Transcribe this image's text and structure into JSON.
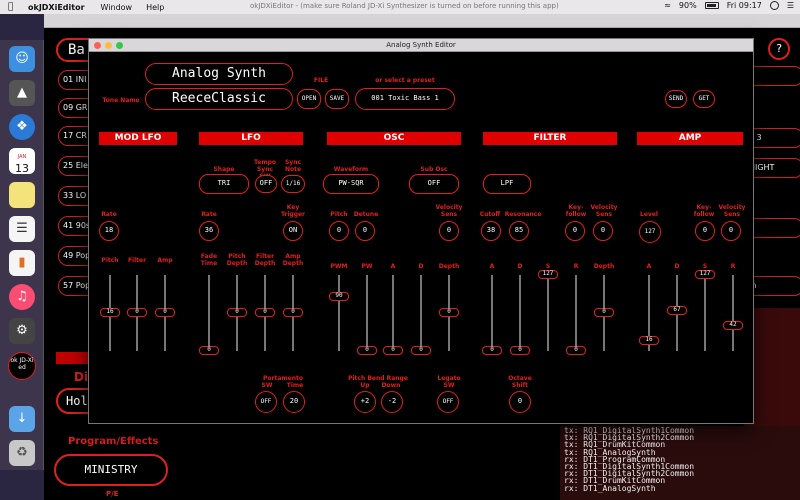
{
  "menubar": {
    "app_name": "okJDXiEditor",
    "items": [
      "Window",
      "Help"
    ],
    "window_title": "okJDXiEditor - (make sure Roland JD-Xi Synthesizer is turned on before running this app)",
    "battery": "90%",
    "clock": "Fri 09:17"
  },
  "dock": {
    "calendar_day": "13",
    "calendar_month": "JAN",
    "app_label": "ok JD-Xi ed"
  },
  "main": {
    "top_button_partial": "Ba",
    "help_button": "?",
    "program_rows": [
      "01 INI",
      "09 GR",
      "17 CR",
      "25 Ele",
      "33 LO",
      "41 90s",
      "49 Pop",
      "57 Pop"
    ],
    "right_rows": [
      "p",
      "o 3",
      "NIGHT",
      "t",
      "In"
    ],
    "section_partial": "Dig",
    "hold_partial": "Hol",
    "program_effects_label": "Program/Effects",
    "preset_button": "MINISTRY",
    "pe_label": "P/E",
    "midi_log": [
      "tx: RQ1_DigitalSynth1Common",
      "tx: RQ1_DigitalSynth2Common",
      "tx: RQ1_DrumKitCommon",
      "tx: RQ1_AnalogSynth",
      "rx: DT1_ProgramCommon",
      "rx: DT1_DigitalSynth1Common",
      "rx: DT1_DigitalSynth2Common",
      "rx: DT1_DrumKitCommon",
      "rx: DT1_AnalogSynth"
    ]
  },
  "editor": {
    "window_title": "Analog Synth Editor",
    "heading": "Analog Synth",
    "tone_name_label": "Tone Name",
    "tone_name": "ReeceClassic",
    "file_label": "FILE",
    "open": "OPEN",
    "save": "SAVE",
    "preset_label": "or select a preset",
    "preset_value": "001 Toxic Bass 1",
    "send": "SEND",
    "get": "GET",
    "sections": {
      "mod_lfo": "MOD LFO",
      "lfo": "LFO",
      "osc": "OSC",
      "filter": "FILTER",
      "amp": "AMP"
    },
    "lfo": {
      "shape_label": "Shape",
      "shape": "TRI",
      "tempo_sync_label": "Tempo Sync SW",
      "tempo_sync": "OFF",
      "sync_note_label": "Sync Note",
      "sync_note": "1/16",
      "rate_label": "Rate",
      "rate": "36",
      "key_trigger_label": "Key Trigger",
      "key_trigger": "ON"
    },
    "mod_lfo": {
      "rate_label": "Rate",
      "rate": "18"
    },
    "osc": {
      "waveform_label": "Waveform",
      "waveform": "PW-SQR",
      "sub_osc_label": "Sub Osc",
      "sub_osc": "OFF",
      "pitch_label": "Pitch",
      "pitch": "0",
      "detune_label": "Detune",
      "detune": "0",
      "vel_sens_label": "Velocity Sens",
      "vel_sens": "0"
    },
    "filter": {
      "type": "LPF",
      "cutoff_label": "Cutoff",
      "cutoff": "38",
      "resonance_label": "Resonance",
      "resonance": "85",
      "keyfollow_label": "Key-follow",
      "keyfollow": "0",
      "vel_sens_label": "Velocity Sens",
      "vel_sens": "0"
    },
    "amp": {
      "level_label": "Level",
      "level": "127",
      "keyfollow_label": "Key-follow",
      "keyfollow": "0",
      "vel_sens_label": "Velocity Sens",
      "vel_sens": "0"
    },
    "sliders": {
      "mod_pitch": {
        "label": "Pitch",
        "value": "16",
        "level": 0.5
      },
      "mod_filter": {
        "label": "Filter",
        "value": "0",
        "level": 0.5
      },
      "mod_amp": {
        "label": "Amp",
        "value": "0",
        "level": 0.5
      },
      "lfo_fade": {
        "label": "Fade Time",
        "value": "0",
        "level": 0.0
      },
      "lfo_pitch": {
        "label": "Pitch Depth",
        "value": "0",
        "level": 0.5
      },
      "lfo_filter": {
        "label": "Filter Depth",
        "value": "0",
        "level": 0.5
      },
      "lfo_amp": {
        "label": "Amp Depth",
        "value": "0",
        "level": 0.5
      },
      "osc_pwm": {
        "label": "PWM",
        "value": "90",
        "level": 0.71
      },
      "osc_pw": {
        "label": "PW",
        "value": "0",
        "level": 0.0
      },
      "osc_a": {
        "label": "A",
        "value": "0",
        "level": 0.0
      },
      "osc_d": {
        "label": "D",
        "value": "0",
        "level": 0.0
      },
      "osc_depth": {
        "label": "Depth",
        "value": "0",
        "level": 0.5
      },
      "flt_a": {
        "label": "A",
        "value": "0",
        "level": 0.0
      },
      "flt_d": {
        "label": "D",
        "value": "0",
        "level": 0.0
      },
      "flt_s": {
        "label": "S",
        "value": "127",
        "level": 1.0
      },
      "flt_r": {
        "label": "R",
        "value": "0",
        "level": 0.0
      },
      "flt_depth": {
        "label": "Depth",
        "value": "0",
        "level": 0.5
      },
      "amp_a": {
        "label": "A",
        "value": "16",
        "level": 0.13
      },
      "amp_d": {
        "label": "D",
        "value": "67",
        "level": 0.53
      },
      "amp_s": {
        "label": "S",
        "value": "127",
        "level": 1.0
      },
      "amp_r": {
        "label": "R",
        "value": "42",
        "level": 0.33
      }
    },
    "bottom": {
      "portamento_label": "Portamento",
      "sw_label": "SW",
      "time_label": "Time",
      "portamento_sw": "OFF",
      "portamento_time": "20",
      "pitch_bend_label": "Pitch Bend Range",
      "up_label": "Up",
      "down_label": "Down",
      "pb_up": "+2",
      "pb_down": "-2",
      "legato_label": "Legato SW",
      "legato": "OFF",
      "octave_label": "Octave Shift",
      "octave": "0"
    }
  }
}
